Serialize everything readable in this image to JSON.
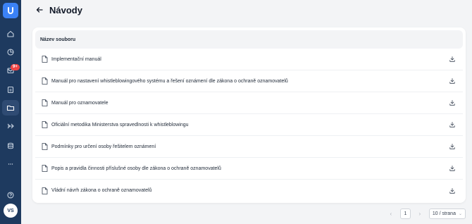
{
  "app": {
    "accent": "#3b82f6",
    "sidebar_bg": "#1e3a5f"
  },
  "sidebar": {
    "badge": "9+",
    "avatar_initials": "VS",
    "items": [
      {
        "icon": "home-icon"
      },
      {
        "icon": "chart-icon"
      },
      {
        "icon": "inbox-icon"
      },
      {
        "icon": "clipboard-icon"
      },
      {
        "icon": "folder-icon"
      },
      {
        "icon": "arrows-icon"
      },
      {
        "icon": "database-icon"
      },
      {
        "icon": "more-icon"
      },
      {
        "icon": "help-icon"
      }
    ]
  },
  "header": {
    "title": "Návody"
  },
  "table": {
    "column_header": "Název souboru",
    "rows": [
      {
        "name": "Implementační manuál"
      },
      {
        "name": "Manuál pro nastavení whistleblowingového systému a řešení oznámení dle zákona o ochraně oznamovatelů"
      },
      {
        "name": "Manuál pro oznamovatele"
      },
      {
        "name": "Oficiální metodika Ministerstva spravedlnosti k whistleblowingu"
      },
      {
        "name": "Podmínky pro určení osoby řešitelem oznámení"
      },
      {
        "name": "Popis a pravidla činnosti příslušné osoby dle zákona o ochraně oznamovatelů"
      },
      {
        "name": "Vládní návrh zákona o ochraně oznamovatelů"
      }
    ]
  },
  "pagination": {
    "prev": "‹",
    "current_page": "1",
    "next": "›",
    "page_size": "10 / strana"
  }
}
